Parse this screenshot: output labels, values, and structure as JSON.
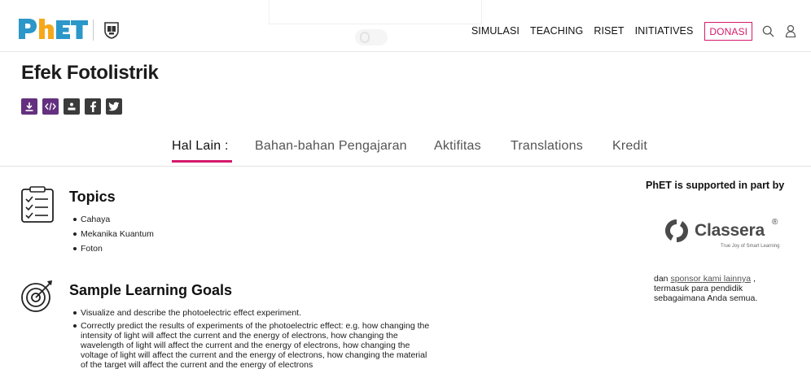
{
  "header": {
    "logo_text": "PhET",
    "nav": [
      {
        "label": "SIMULASI"
      },
      {
        "label": "TEACHING"
      },
      {
        "label": "RISET"
      },
      {
        "label": "INITIATIVES"
      }
    ],
    "donate_label": "DONASI",
    "search_icon": "search-icon",
    "user_icon": "user-icon"
  },
  "page": {
    "title": "Efek Fotolistrik"
  },
  "share_icons": [
    "download-icon",
    "embed-icon",
    "share-icon",
    "facebook-icon",
    "twitter-icon"
  ],
  "tabs": [
    {
      "label": "Hal Lain :"
    },
    {
      "label": "Bahan-bahan Pengajaran"
    },
    {
      "label": "Aktifitas"
    },
    {
      "label": "Translations"
    },
    {
      "label": "Kredit"
    }
  ],
  "topics": {
    "title": "Topics",
    "items": [
      "Cahaya",
      "Mekanika Kuantum",
      "Foton"
    ]
  },
  "goals": {
    "title": "Sample Learning Goals",
    "items": [
      "Visualize and describe the photoelectric effect experiment.",
      "Correctly predict the results of experiments of the photoelectric effect: e.g. how changing the intensity of light will affect the current and the energy of electrons, how changing the wavelength of light will affect the current and the energy of electrons, how changing the voltage of light will affect the current and the energy of electrons, how changing the material of the target will affect the current and the energy of electrons"
    ]
  },
  "sidebar": {
    "heading": "PhET is supported in part by",
    "sponsor_name": "Classera",
    "sponsor_reg": "®",
    "sponsor_tagline": "True Joy of Smart Learning",
    "text_before": "dan ",
    "link": "sponsor kami lainnya",
    "text_after": " , termasuk para pendidik sebagaimana Anda semua."
  },
  "colors": {
    "accent": "#d6196b",
    "share_purple": "#64307f",
    "share_dark": "#3b3b3b",
    "logo_blue": "#2c97c9",
    "logo_orange": "#f6a81c"
  }
}
